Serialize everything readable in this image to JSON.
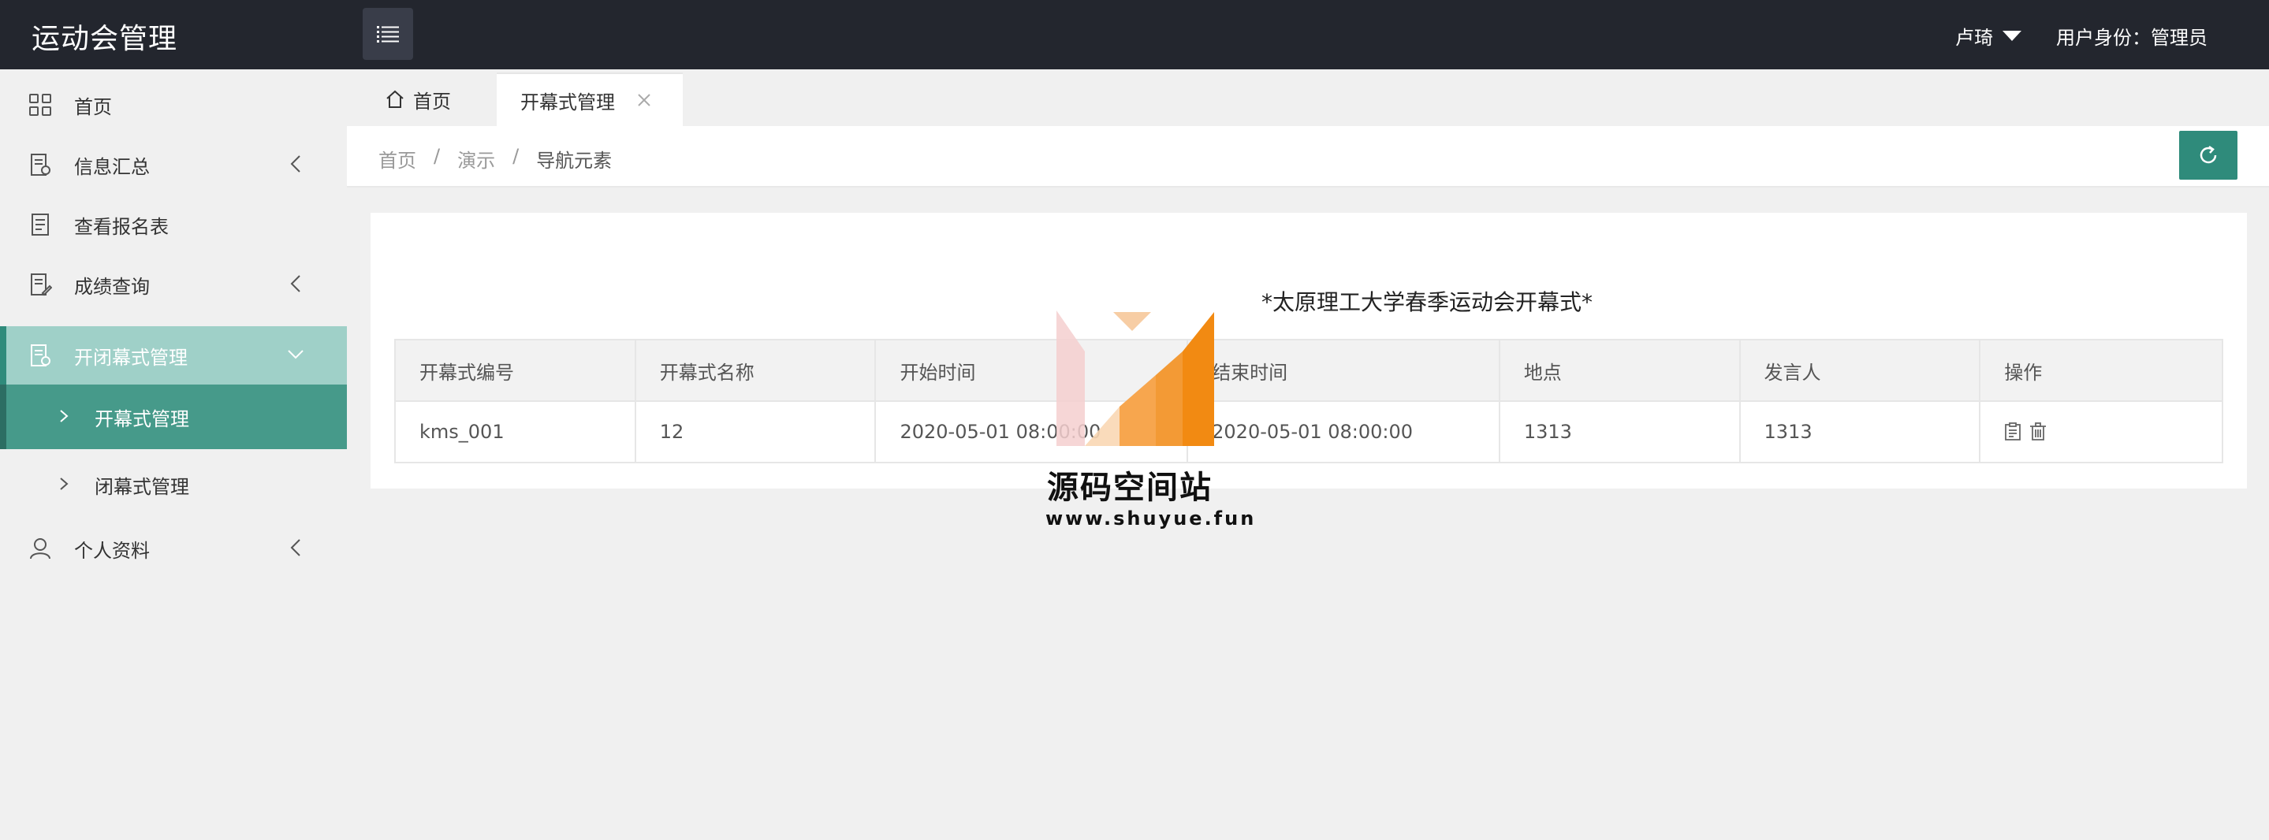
{
  "header": {
    "app_title": "运动会管理",
    "user_name": "卢琦",
    "user_role": "用户身份：管理员"
  },
  "sidebar": {
    "items": [
      {
        "label": "首页",
        "icon": "grid-icon"
      },
      {
        "label": "信息汇总",
        "icon": "document-icon"
      },
      {
        "label": "查看报名表",
        "icon": "list-doc-icon"
      },
      {
        "label": "成绩查询",
        "icon": "edit-doc-icon"
      },
      {
        "label": "开闭幕式管理",
        "icon": "settings-doc-icon"
      },
      {
        "label": "个人资料",
        "icon": "user-icon"
      }
    ],
    "subitems": [
      {
        "label": "开幕式管理"
      },
      {
        "label": "闭幕式管理"
      }
    ]
  },
  "tabs": {
    "home": "首页",
    "current": "开幕式管理"
  },
  "breadcrumb": [
    "首页",
    "/",
    "演示",
    "/",
    "导航元素"
  ],
  "table": {
    "title": "*太原理工大学春季运动会开幕式*",
    "headers": [
      "开幕式编号",
      "开幕式名称",
      "开始时间",
      "结束时间",
      "地点",
      "发言人",
      "操作"
    ],
    "rows": [
      [
        "kms_001",
        "12",
        "2020-05-01 08:00:00",
        "2020-05-01 08:00:00",
        "1313",
        "1313"
      ]
    ]
  },
  "watermark": {
    "text": "源码空间站",
    "url": "www.shuyue.fun"
  },
  "colors": {
    "header_bg": "#23262e",
    "accent": "#2f8b7b",
    "sidebar_open": "#9fd0c8",
    "sidebar_active": "#469a8a"
  }
}
